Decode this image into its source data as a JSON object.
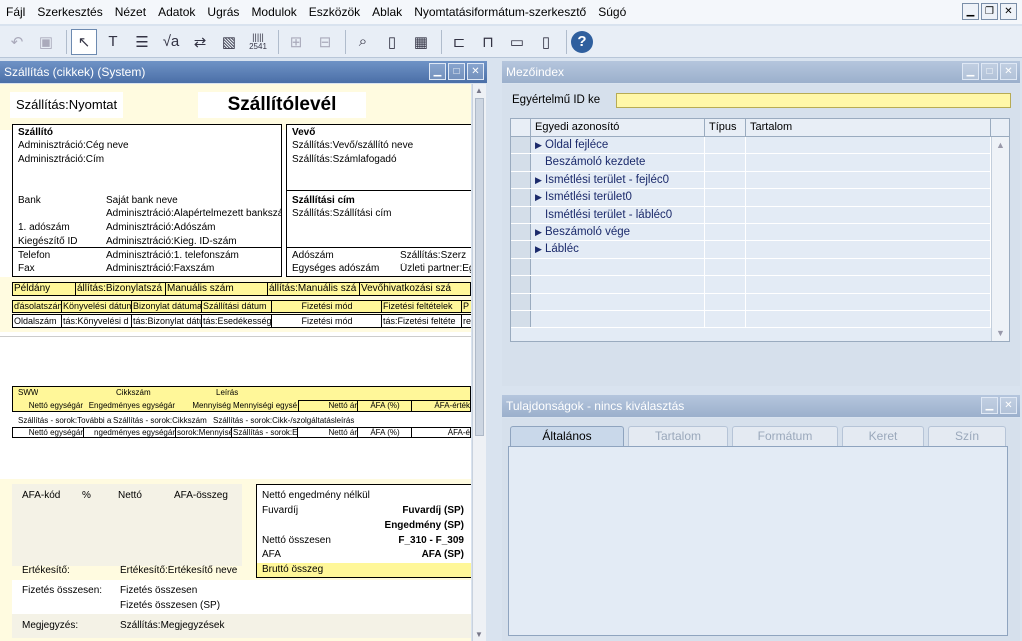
{
  "menu": [
    "Fájl",
    "Szerkesztés",
    "Nézet",
    "Adatok",
    "Ugrás",
    "Modulok",
    "Eszközök",
    "Ablak",
    "Nyomtatásiformátum-szerkesztő",
    "Súgó"
  ],
  "toolbar": {
    "barcode_label": "2541"
  },
  "left_panel": {
    "title": "Szállítás (cikkek) (System)",
    "header_left": "Szállítás:Nyomtat",
    "header_title": "Szállítólevél",
    "supplier": {
      "heading": "Szállító",
      "line1": "Adminisztráció:Cég neve",
      "line2": "Adminisztráció:Cím",
      "bank_label": "Bank",
      "bank_value": "Saját bank neve",
      "bank_admin": "Adminisztráció:Alapértelmezett bankszámla",
      "tax1_label": "1. adószám",
      "tax1_value": "Adminisztráció:Adószám",
      "kieg_label": "Kiegészítő ID",
      "kieg_value": "Adminisztráció:Kieg. ID-szám",
      "phone_label": "Telefon",
      "phone_value": "Adminisztráció:1. telefonszám",
      "fax_label": "Fax",
      "fax_value": "Adminisztráció:Faxszám"
    },
    "buyer": {
      "heading": "Vevő",
      "line1": "Szállítás:Vevő/szállító neve",
      "line2": "Szállítás:Számlafogadó",
      "ship_heading": "Szállítási cím",
      "ship_line": "Szállítás:Szállítási cím",
      "tax_label": "Adószám",
      "tax_value": "Szállítás:Szerz",
      "group_tax_label": "Egységes adószám",
      "group_tax_value": "Üzleti partner:Eg"
    },
    "info_row": [
      "Példány",
      "állítás:Bizonylatszá",
      "Manuális szám",
      "állítás:Manuális szá",
      "Vevőhivatkozási szá"
    ],
    "table1_head": [
      "ďásolatszám",
      "Könyvelési dátum",
      "Bizonylat dátuma",
      "Szállítási dátum",
      "Fizetési mód",
      "Fizetési feltételek",
      "P"
    ],
    "table1_row": [
      "Oldalszám",
      "tás:Könyvelési d",
      "tás:Bizonylat dátu",
      "tás:Esedékességi",
      "Fizetési mód",
      "tás:Fizetési feltéte",
      "ren"
    ],
    "items_head_top": [
      "SWW",
      "Cikkszám",
      "Leírás"
    ],
    "items_head_bottom": [
      "Nettó egységár",
      "Engedményes egységár",
      "Mennyiség",
      "Mennyiségi egység",
      "Nettó ár",
      "ÁFA (%)",
      "ÁFA-érték"
    ],
    "items_row_top": [
      "Szállítás - sorok:További azo",
      "Szállítás - sorok:Cikkszám",
      "Szállítás - sorok:Cikk-/szolgáltatásleírás"
    ],
    "items_row_bottom": [
      "Nettó egységár",
      "ngedményes egységár",
      "sorok:Mennyiség",
      "Szállítás - sorok:Eg",
      "Nettó ár",
      "ÁFA (%)",
      "ÁFA-é"
    ],
    "vat_head": [
      "ÁFA-kód",
      "%",
      "Nettó",
      "ÁFA-összeg"
    ],
    "totals": {
      "discount_free": "Nettó engedmény nélkül",
      "freight_label": "Fuvardíj",
      "freight_value": "Fuvardíj (SP)",
      "discount_value": "Engedmény (SP)",
      "net_total_label": "Nettó összesen",
      "net_total_value": "F_310 - F_309",
      "vat_label": "ÁFA",
      "vat_value": "ÁFA (SP)",
      "gross_label": "Bruttó összeg"
    },
    "seller_label": "Értékesítő:",
    "seller_value": "Értékesítő:Értékesítő neve",
    "pay_label": "Fizetés összesen:",
    "pay_value1": "Fizetés összesen",
    "pay_value2": "Fizetés összesen (SP)",
    "note_label": "Megjegyzés:",
    "note_value": "Szállítás:Megjegyzések"
  },
  "field_index": {
    "title": "Mezőindex",
    "uid_label": "Egyértelmű ID ke",
    "columns": [
      "Egyedi azonosító",
      "Típus",
      "Tartalom"
    ],
    "rows": [
      {
        "expand": "▶",
        "label": "Oldal fejléce"
      },
      {
        "expand": "",
        "label": "Beszámoló kezdete"
      },
      {
        "expand": "▶",
        "label": "Ismétlési terület - fejléc0"
      },
      {
        "expand": "▶",
        "label": "Ismétlési terület0"
      },
      {
        "expand": "",
        "label": "Ismétlési terület - lábléc0"
      },
      {
        "expand": "▶",
        "label": "Beszámoló vége"
      },
      {
        "expand": "▶",
        "label": "Lábléc"
      }
    ]
  },
  "properties": {
    "title": "Tulajdonságok - nincs kiválasztás",
    "tabs": [
      "Általános",
      "Tartalom",
      "Formátum",
      "Keret",
      "Szín"
    ]
  }
}
